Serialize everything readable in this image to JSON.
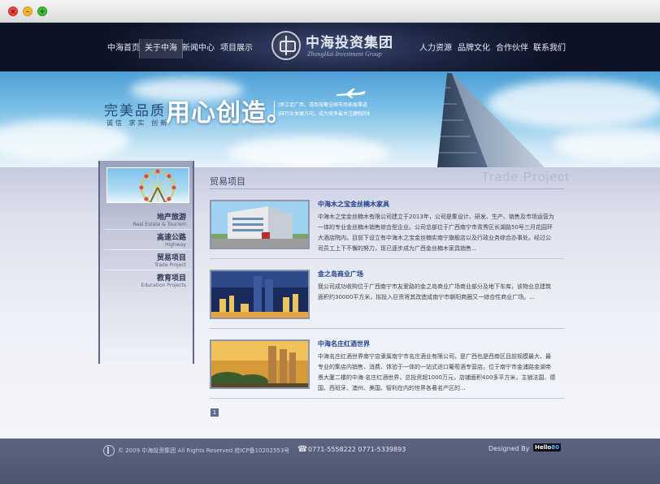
{
  "nav": {
    "items": [
      {
        "label": "中海首页",
        "active": false
      },
      {
        "label": "关于中海",
        "active": true
      },
      {
        "label": "新闻中心",
        "active": false
      },
      {
        "label": "项目展示",
        "active": false
      },
      {
        "label": "人力资源",
        "active": false
      },
      {
        "label": "品牌文化",
        "active": false
      },
      {
        "label": "合作伙伴",
        "active": false
      },
      {
        "label": "联系我们",
        "active": false
      }
    ],
    "logo_cn": "中海投资集团",
    "logo_en": "ZhongHai Investment Group"
  },
  "banner": {
    "slogan_small": "完美品质",
    "slogan_big": "用心创造。",
    "slogan_sub": "诚信  求实  创新",
    "desc_lines": [
      "|承立足广西，透而效聚全国市场拓展渠道",
      "|研行业发展方向，成为竞争最关注建制的标杆"
    ]
  },
  "sidebar": {
    "items": [
      {
        "cn": "地产旅游",
        "en": "Real Estate & Tourism"
      },
      {
        "cn": "高速公路",
        "en": "Highway"
      },
      {
        "cn": "贸易项目",
        "en": "Trade Project"
      },
      {
        "cn": "教育项目",
        "en": "Education Projects"
      }
    ]
  },
  "main": {
    "section_title": "贸易项目",
    "section_watermark": "Trade Project",
    "items": [
      {
        "title": "中海木之宝金丝楠木家具",
        "lines": [
          "中海木之宝金丝楠木有限公司建立于2013年，公司是集设计、研发、生产、销售及市场运营为",
          "一体的专业金丝楠木销售综合型企业。公司总部位于广西南宁市青秀区长湖路50号三月花园环",
          "大酒店院内。目前下设立有中海木之宝金丝楠实南宁旗舰店以及行政业务综合办事处。经过公",
          "司员工上下不懈的努力，现已逐步成为广西金丝楠木家具销售..."
        ]
      },
      {
        "title": "金之岛商业广场",
        "lines": [
          "我公司成功收购位于广西南宁市友爱路的金之岛商业广场商业部分及地下车库，该物业总建筑",
          "面积约30000平方米，拟投入巨资将其改造成南宁市朝阳商圈又一综合性商业广场。..."
        ]
      },
      {
        "title": "中海名庄红酒世界",
        "lines": [
          "中海名庄红酒世界南宁店隶属南宁市名庄酒业有限公司，是广西也是西南区目前规模最大、最",
          "专业的集店内销售、消费、体验于一体的一站式进口葡萄酒专营店。位于南宁市金浦路金湖帝",
          "景大厦二楼的中海·名庄红酒世界，总投资超1000万元，店铺面积400多平方米，主销法国、德",
          "国、西班牙、澳州、美国、智利在内的世界各著名产区的..."
        ]
      }
    ],
    "pager_current": "1"
  },
  "footer": {
    "copyright": "© 2009 中海投资集团 All Rights Reserved  桂ICP备10202553号",
    "phones": "0771-5558222   0771-5339893",
    "designed_by": "Designed By",
    "badge": "Hello",
    "badge_suffix": "80"
  },
  "colors": {
    "nav_bg": "#1b2440",
    "item_title": "#1f3e8c",
    "footer_bg": "#5d6480"
  }
}
